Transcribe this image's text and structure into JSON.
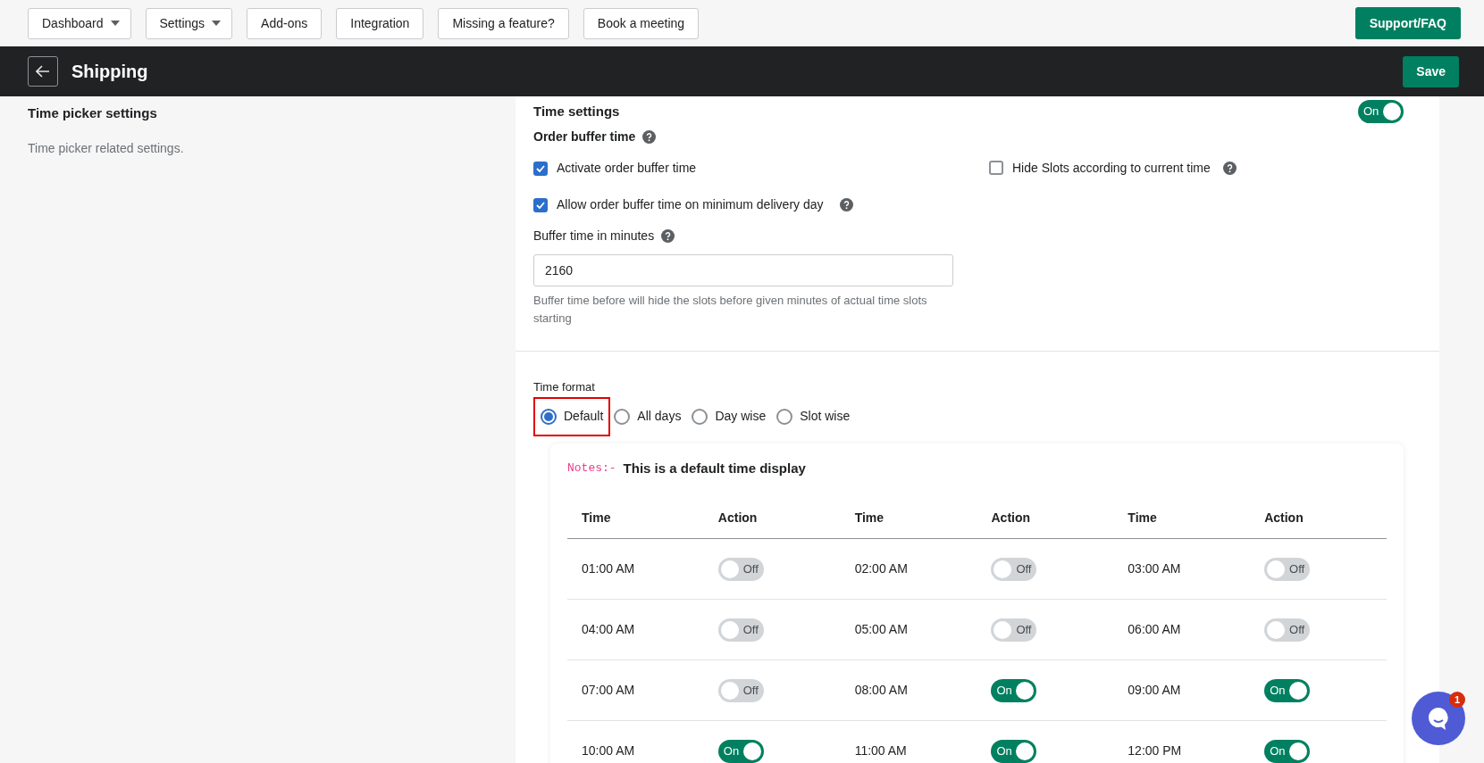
{
  "nav": {
    "buttons": [
      {
        "label": "Dashboard",
        "dropdown": true
      },
      {
        "label": "Settings",
        "dropdown": true
      },
      {
        "label": "Add-ons",
        "dropdown": false
      },
      {
        "label": "Integration",
        "dropdown": false
      },
      {
        "label": "Missing a feature?",
        "dropdown": false
      },
      {
        "label": "Book a meeting",
        "dropdown": false
      }
    ],
    "support": "Support/FAQ"
  },
  "header": {
    "title": "Shipping",
    "save": "Save"
  },
  "sidebar": {
    "title": "Time picker settings",
    "description": "Time picker related settings."
  },
  "time_settings": {
    "title": "Time settings",
    "toggle": {
      "on": true,
      "label": "On"
    },
    "order_buffer_label": "Order buffer time",
    "checkboxes": [
      {
        "label": "Activate order buffer time",
        "checked": true,
        "help": false
      },
      {
        "label": "Allow order buffer time on minimum delivery day",
        "checked": true,
        "help": true
      }
    ],
    "hide_slots": {
      "label": "Hide Slots according to current time",
      "checked": false
    },
    "buffer_label": "Buffer time in minutes",
    "buffer_value": "2160",
    "buffer_hint": "Buffer time before will hide the slots before given minutes of actual time slots starting"
  },
  "time_format": {
    "label": "Time format",
    "options": [
      {
        "label": "Default",
        "selected": true,
        "highlighted": true
      },
      {
        "label": "All days",
        "selected": false,
        "highlighted": false
      },
      {
        "label": "Day wise",
        "selected": false,
        "highlighted": false
      },
      {
        "label": "Slot wise",
        "selected": false,
        "highlighted": false
      }
    ]
  },
  "notes": {
    "prefix": "Notes:-",
    "text": "This is a default time display"
  },
  "table": {
    "columns": [
      "Time",
      "Action",
      "Time",
      "Action",
      "Time",
      "Action"
    ],
    "slots": [
      {
        "time": "01:00 AM",
        "on": false,
        "label": "Off"
      },
      {
        "time": "02:00 AM",
        "on": false,
        "label": "Off"
      },
      {
        "time": "03:00 AM",
        "on": false,
        "label": "Off"
      },
      {
        "time": "04:00 AM",
        "on": false,
        "label": "Off"
      },
      {
        "time": "05:00 AM",
        "on": false,
        "label": "Off"
      },
      {
        "time": "06:00 AM",
        "on": false,
        "label": "Off"
      },
      {
        "time": "07:00 AM",
        "on": false,
        "label": "Off"
      },
      {
        "time": "08:00 AM",
        "on": true,
        "label": "On"
      },
      {
        "time": "09:00 AM",
        "on": true,
        "label": "On"
      },
      {
        "time": "10:00 AM",
        "on": true,
        "label": "On"
      },
      {
        "time": "11:00 AM",
        "on": true,
        "label": "On"
      },
      {
        "time": "12:00 PM",
        "on": true,
        "label": "On"
      }
    ]
  },
  "chat": {
    "badge": "1"
  }
}
